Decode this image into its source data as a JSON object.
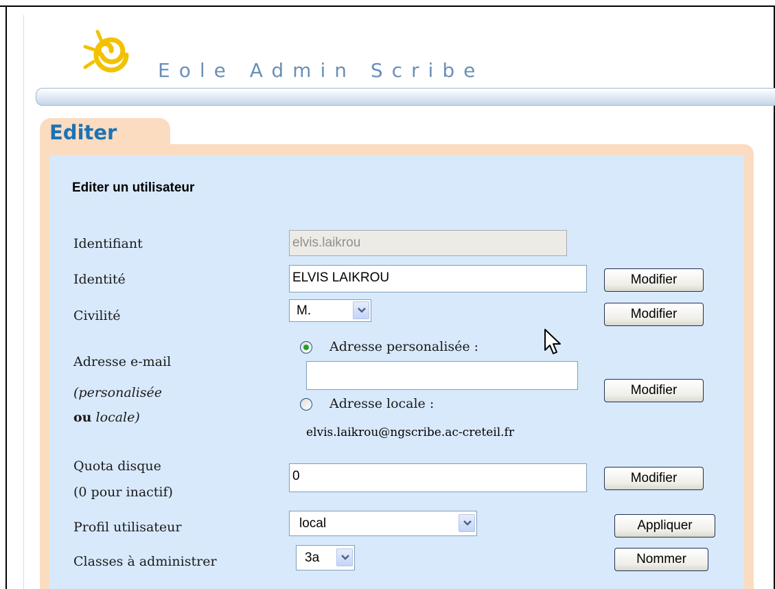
{
  "app": {
    "title": "Eole Admin Scribe"
  },
  "tab": {
    "label": "Editer"
  },
  "form": {
    "heading": "Editer un utilisateur",
    "identifiant": {
      "label": "Identifiant",
      "value": "elvis.laikrou"
    },
    "identite": {
      "label": "Identité",
      "value": "ELVIS LAIKROU",
      "button": "Modifier"
    },
    "civilite": {
      "label": "Civilité",
      "value": "M.",
      "button": "Modifier"
    },
    "email": {
      "label_line1": "Adresse e-mail",
      "label_line2": "(personalisée",
      "label_ou": "ou",
      "label_line3": "locale)",
      "option_perso": "Adresse personalisée :",
      "perso_value": "",
      "option_locale": "Adresse locale :",
      "locale_value": "elvis.laikrou@ngscribe.ac-creteil.fr",
      "selected": "perso",
      "button": "Modifier"
    },
    "quota": {
      "label_line1": "Quota disque",
      "label_line2": "(0 pour inactif)",
      "value": "0",
      "button": "Modifier"
    },
    "profil": {
      "label": "Profil utilisateur",
      "value": "local",
      "button": "Appliquer"
    },
    "classes": {
      "label": "Classes à administrer",
      "value": "3a",
      "button": "Nommer"
    }
  },
  "colors": {
    "accent": "#1b73b5",
    "panel": "#d8e9fb",
    "tab": "#fbdcc0",
    "radio_selected": "#21a121"
  }
}
